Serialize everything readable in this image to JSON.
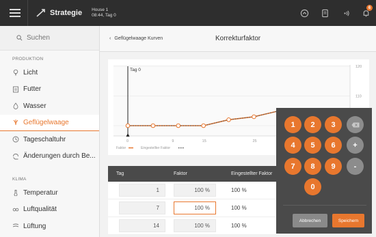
{
  "header": {
    "app_title": "Strategie",
    "house_name": "House 1",
    "house_info": "08:44, Tag 0",
    "badge_count": "6"
  },
  "sidebar": {
    "search_placeholder": "Suchen",
    "section_produktion": "PRODUKTION",
    "produktion_items": [
      {
        "label": "Licht",
        "icon": "bulb-icon"
      },
      {
        "label": "Futter",
        "icon": "feed-icon"
      },
      {
        "label": "Wasser",
        "icon": "water-drop-icon"
      },
      {
        "label": "Geflügelwaage",
        "icon": "poultry-scale-icon"
      },
      {
        "label": "Tageschaltuhr",
        "icon": "clock-icon"
      },
      {
        "label": "Änderungen durch Be...",
        "icon": "changes-icon"
      }
    ],
    "section_klima": "KLIMA",
    "klima_items": [
      {
        "label": "Temperatur",
        "icon": "thermometer-icon"
      },
      {
        "label": "Luftqualität",
        "icon": "air-quality-icon"
      },
      {
        "label": "Lüftung",
        "icon": "ventilation-icon"
      }
    ]
  },
  "main": {
    "back_label": "Geflügelwaage Kurven",
    "title": "Korrekturfaktor"
  },
  "chart_data": {
    "type": "line",
    "marker_label": "Tag 0",
    "x_ticks": [
      "0",
      "9",
      "15",
      "25"
    ],
    "y_ticks": [
      "120",
      "110",
      "100"
    ],
    "y_unit": "%",
    "ylim": [
      100,
      120
    ],
    "series": [
      {
        "name": "Faktor",
        "color": "#e8772e",
        "x": [
          0,
          5,
          10,
          15,
          20,
          25,
          30,
          35,
          40,
          45
        ],
        "y": [
          100,
          100,
          100,
          100,
          102,
          103,
          105,
          105,
          105,
          105
        ]
      },
      {
        "name": "Eingestellter Faktor",
        "color": "#555555",
        "dashed": true,
        "x": [
          0,
          5,
          10,
          15,
          20,
          25,
          30,
          35,
          40,
          45
        ],
        "y": [
          100,
          100,
          100,
          100,
          102,
          103,
          105,
          105,
          105,
          105
        ]
      }
    ]
  },
  "table": {
    "headers": {
      "tag": "Tag",
      "faktor": "Faktor",
      "eingestellter": "Eingestellter Faktor"
    },
    "rows": [
      {
        "tag": "1",
        "faktor": "100 %",
        "eingestellter": "100 %"
      },
      {
        "tag": "7",
        "faktor": "100 %",
        "eingestellter": "100 %"
      },
      {
        "tag": "14",
        "faktor": "100 %",
        "eingestellter": "100 %"
      }
    ]
  },
  "keypad": {
    "keys": [
      "1",
      "2",
      "3",
      "4",
      "5",
      "6",
      "7",
      "8",
      "9",
      "0"
    ],
    "plus": "+",
    "minus": "-",
    "cancel_label": "Abbrechen",
    "save_label": "Speichern"
  },
  "colors": {
    "accent": "#e8772e",
    "header_bg": "#2e2e2e",
    "keypad_bg": "#4a4a4a"
  }
}
